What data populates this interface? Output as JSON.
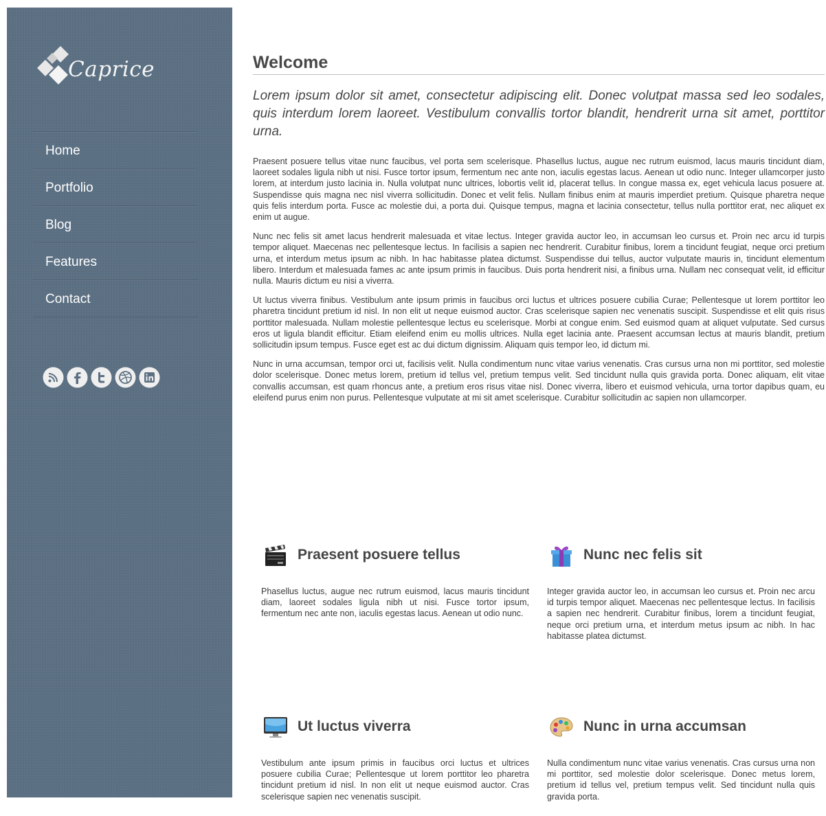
{
  "brand": {
    "name": "Caprice"
  },
  "nav": {
    "items": [
      "Home",
      "Portfolio",
      "Blog",
      "Features",
      "Contact"
    ]
  },
  "social": {
    "icons": [
      "rss-icon",
      "facebook-icon",
      "twitter-icon",
      "dribbble-icon",
      "linkedin-icon"
    ]
  },
  "colors": {
    "sidebar": "#5b6f82",
    "text": "#444444"
  },
  "main": {
    "title": "Welcome",
    "lead": "Lorem ipsum dolor sit amet, consectetur adipiscing elit. Donec volutpat massa sed leo sodales, quis interdum lorem laoreet. Vestibulum convallis tortor blandit, hendrerit urna sit amet, porttitor urna.",
    "paragraphs": [
      "Praesent posuere tellus vitae nunc faucibus, vel porta sem scelerisque. Phasellus luctus, augue nec rutrum euismod, lacus mauris tincidunt diam, laoreet sodales ligula nibh ut nisi. Fusce tortor ipsum, fermentum nec ante non, iaculis egestas lacus. Aenean ut odio nunc. Integer ullamcorper justo lorem, at interdum justo lacinia in. Nulla volutpat nunc ultrices, lobortis velit id, placerat tellus. In congue massa ex, eget vehicula lacus posuere at. Suspendisse quis magna nec nisl viverra sollicitudin. Donec et velit felis. Nullam finibus enim at mauris imperdiet pretium. Quisque pharetra neque quis felis interdum porta. Fusce ac molestie dui, a porta dui. Quisque tempus, magna et lacinia consectetur, tellus nulla porttitor erat, nec aliquet ex enim ut augue.",
      "Nunc nec felis sit amet lacus hendrerit malesuada et vitae lectus. Integer gravida auctor leo, in accumsan leo cursus et. Proin nec arcu id turpis tempor aliquet. Maecenas nec pellentesque lectus. In facilisis a sapien nec hendrerit. Curabitur finibus, lorem a tincidunt feugiat, neque orci pretium urna, et interdum metus ipsum ac nibh. In hac habitasse platea dictumst. Suspendisse dui tellus, auctor vulputate mauris in, tincidunt elementum libero. Interdum et malesuada fames ac ante ipsum primis in faucibus. Duis porta hendrerit nisi, a finibus urna. Nullam nec consequat velit, id efficitur nulla. Mauris dictum eu nisi a viverra.",
      "Ut luctus viverra finibus. Vestibulum ante ipsum primis in faucibus orci luctus et ultrices posuere cubilia Curae; Pellentesque ut lorem porttitor leo pharetra tincidunt pretium id nisl. In non elit ut neque euismod auctor. Cras scelerisque sapien nec venenatis suscipit. Suspendisse et elit quis risus porttitor malesuada. Nullam molestie pellentesque lectus eu scelerisque. Morbi at congue enim. Sed euismod quam at aliquet vulputate. Sed cursus eros ut ligula blandit efficitur. Etiam eleifend enim eu mollis ultrices. Nulla eget lacinia ante. Praesent accumsan lectus at mauris blandit, pretium sollicitudin ipsum tempus. Fusce eget est ac dui dictum dignissim. Aliquam quis tempor leo, id dictum mi.",
      "Nunc in urna accumsan, tempor orci ut, facilisis velit. Nulla condimentum nunc vitae varius venenatis. Cras cursus urna non mi porttitor, sed molestie dolor scelerisque. Donec metus lorem, pretium id tellus vel, pretium tempus velit. Sed tincidunt nulla quis gravida porta. Donec aliquam, elit vitae convallis accumsan, est quam rhoncus ante, a pretium eros risus vitae nisl. Donec viverra, libero et euismod vehicula, urna tortor dapibus quam, eu eleifend purus enim non purus. Pellentesque vulputate at mi sit amet scelerisque. Curabitur sollicitudin ac sapien non ullamcorper."
    ]
  },
  "features": [
    {
      "icon": "clapperboard-icon",
      "title": "Praesent posuere tellus",
      "text": "Phasellus luctus, augue nec rutrum euismod, lacus mauris tincidunt diam, laoreet sodales ligula nibh ut nisi. Fusce tortor ipsum, fermentum nec ante non, iaculis egestas lacus. Aenean ut odio nunc."
    },
    {
      "icon": "gift-icon",
      "title": "Nunc nec felis sit",
      "text": "Integer gravida auctor leo, in accumsan leo cursus et. Proin nec arcu id turpis tempor aliquet. Maecenas nec pellentesque lectus. In facilisis a sapien nec hendrerit. Curabitur finibus, lorem a tincidunt feugiat, neque orci pretium urna, et interdum metus ipsum ac nibh. In hac habitasse platea dictumst."
    },
    {
      "icon": "monitor-icon",
      "title": "Ut luctus viverra",
      "text": "Vestibulum ante ipsum primis in faucibus orci luctus et ultrices posuere cubilia Curae; Pellentesque ut lorem porttitor leo pharetra tincidunt pretium id nisl. In non elit ut neque euismod auctor. Cras scelerisque sapien nec venenatis suscipit."
    },
    {
      "icon": "palette-icon",
      "title": "Nunc in urna accumsan",
      "text": "Nulla condimentum nunc vitae varius venenatis. Cras cursus urna non mi porttitor, sed molestie dolor scelerisque. Donec metus lorem, pretium id tellus vel, pretium tempus velit. Sed tincidunt nulla quis gravida porta."
    }
  ]
}
